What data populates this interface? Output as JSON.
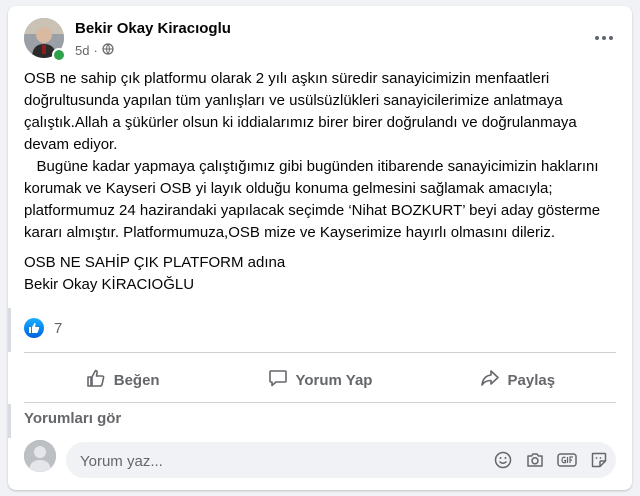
{
  "post": {
    "author": "Bekir Okay Kiracıoglu",
    "time": "5d",
    "audience_icon": "globe-icon",
    "paragraphs": [
      "OSB ne sahip çık platformu olarak 2 yılı aşkın süredir sanayicimizin menfaatleri doğrultusunda yapılan tüm yanlışları ve usülsüzlükleri sanayicilerimize anlatmaya çalıştık.Allah a  şükürler olsun ki iddialarımız birer birer doğrulandı ve doğrulanmaya devam ediyor.",
      "   Bugüne kadar yapmaya çalıştığımız gibi bugünden itibarende sanayicimizin haklarını korumak ve Kayseri OSB yi layık olduğu konuma gelmesini sağlamak amacıyla; platformumuz 24 hazirandaki yapılacak seçimde ‘Nihat BOZKURT’ beyi aday gösterme kararı almıştır. Platformumuza,OSB mize ve Kayserimize hayırlı olmasını dileriz.",
      "OSB NE SAHİP ÇIK PLATFORM adına",
      "Bekir Okay KİRACIOĞLU"
    ]
  },
  "reactions": {
    "count": "7",
    "icon": "like-reaction-icon"
  },
  "actions": {
    "like": "Beğen",
    "comment": "Yorum Yap",
    "share": "Paylaş"
  },
  "comments": {
    "see_label": "Yorumları gör",
    "placeholder": "Yorum yaz...",
    "tools": [
      "emoji-icon",
      "camera-icon",
      "gif-icon",
      "sticker-icon"
    ]
  },
  "colors": {
    "accent": "#1877f2",
    "text": "#050505",
    "muted": "#65676b",
    "online": "#31a24c"
  }
}
